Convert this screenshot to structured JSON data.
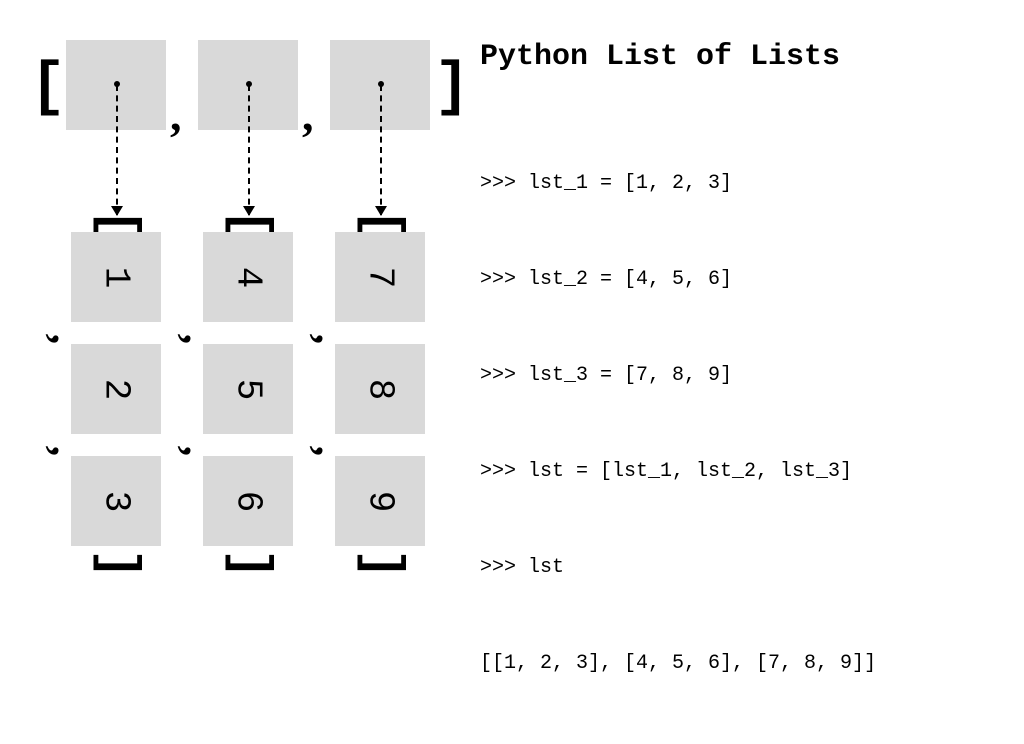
{
  "title": "Python List of Lists",
  "code_lines": [
    ">>> lst_1 = [1, 2, 3]",
    ">>> lst_2 = [4, 5, 6]",
    ">>> lst_3 = [7, 8, 9]",
    ">>> lst = [lst_1, lst_2, lst_3]",
    ">>> lst",
    "[[1, 2, 3], [4, 5, 6], [7, 8, 9]]"
  ],
  "outer_list": {
    "open": "[",
    "close": "]",
    "comma": ","
  },
  "sublists": [
    {
      "values": [
        "1",
        "2",
        "3"
      ]
    },
    {
      "values": [
        "4",
        "5",
        "6"
      ]
    },
    {
      "values": [
        "7",
        "8",
        "9"
      ]
    }
  ],
  "chart_data": {
    "type": "table",
    "title": "Python List of Lists",
    "structure": "list of 3 lists",
    "data": [
      [
        1,
        2,
        3
      ],
      [
        4,
        5,
        6
      ],
      [
        7,
        8,
        9
      ]
    ]
  }
}
